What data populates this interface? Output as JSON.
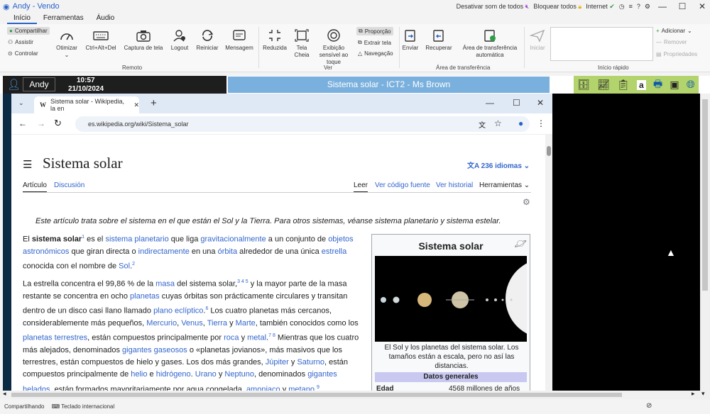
{
  "app": {
    "title": "Andy - Vendo"
  },
  "titlebar": {
    "mute_all": "Desativar som de todos",
    "lock_all": "Bloquear todos",
    "internet": "Internet"
  },
  "menu_tabs": [
    "Início",
    "Ferramentas",
    "Áudio"
  ],
  "ribbon": {
    "share": "Compartilhar",
    "assist": "Assistir",
    "control": "Controlar",
    "optimize": "Otimizar",
    "ctrl_alt_del": "Ctrl+Alt+Del",
    "screenshot": "Captura de tela",
    "logout": "Logout",
    "restart": "Reiniciar",
    "message": "Mensagem",
    "reduced": "Reduzida",
    "fullscreen": "Tela Cheia",
    "touch": "Exibição sensível ao toque",
    "proportion": "Proporção",
    "extract_screen": "Extrair tela",
    "navigation": "Navegação",
    "send": "Enviar",
    "retrieve": "Recuperar",
    "auto_transfer": "Área de transferência automática",
    "start": "Iniciar",
    "add": "Adicionar",
    "remove": "Remover",
    "properties": "Propriedades",
    "group_remote": "Remoto",
    "group_view": "Ver",
    "group_transfer": "Área de transferência",
    "group_quick": "Início rápido"
  },
  "session": {
    "user": "Andy",
    "time": "10:57",
    "date": "21/10/2024",
    "title": "Sistema solar - ICT2 - Ms Brown"
  },
  "browser": {
    "tab_title": "Sistema solar - Wikipedia, la en",
    "url": "es.wikipedia.org/wiki/Sistema_solar"
  },
  "article": {
    "title": "Sistema solar",
    "languages": "236 idiomas",
    "tab_article": "Artículo",
    "tab_discussion": "Discusión",
    "tab_read": "Leer",
    "tab_source": "Ver código fuente",
    "tab_history": "Ver historial",
    "tab_tools": "Herramientas",
    "hatnote": "Este artículo trata sobre el sistema en el que están el Sol y la Tierra. Para otros sistemas, véanse sistema planetario y sistema estelar."
  },
  "infobox": {
    "title": "Sistema solar",
    "caption": "El Sol y los planetas del sistema solar. Los tamaños están a escala, pero no así las distancias.",
    "section": "Datos generales",
    "row_label": "Edad",
    "row_value": "4568 millones de años"
  },
  "statusbar": {
    "sharing": "Compartilhando",
    "keyboard": "Teclado internacional"
  }
}
